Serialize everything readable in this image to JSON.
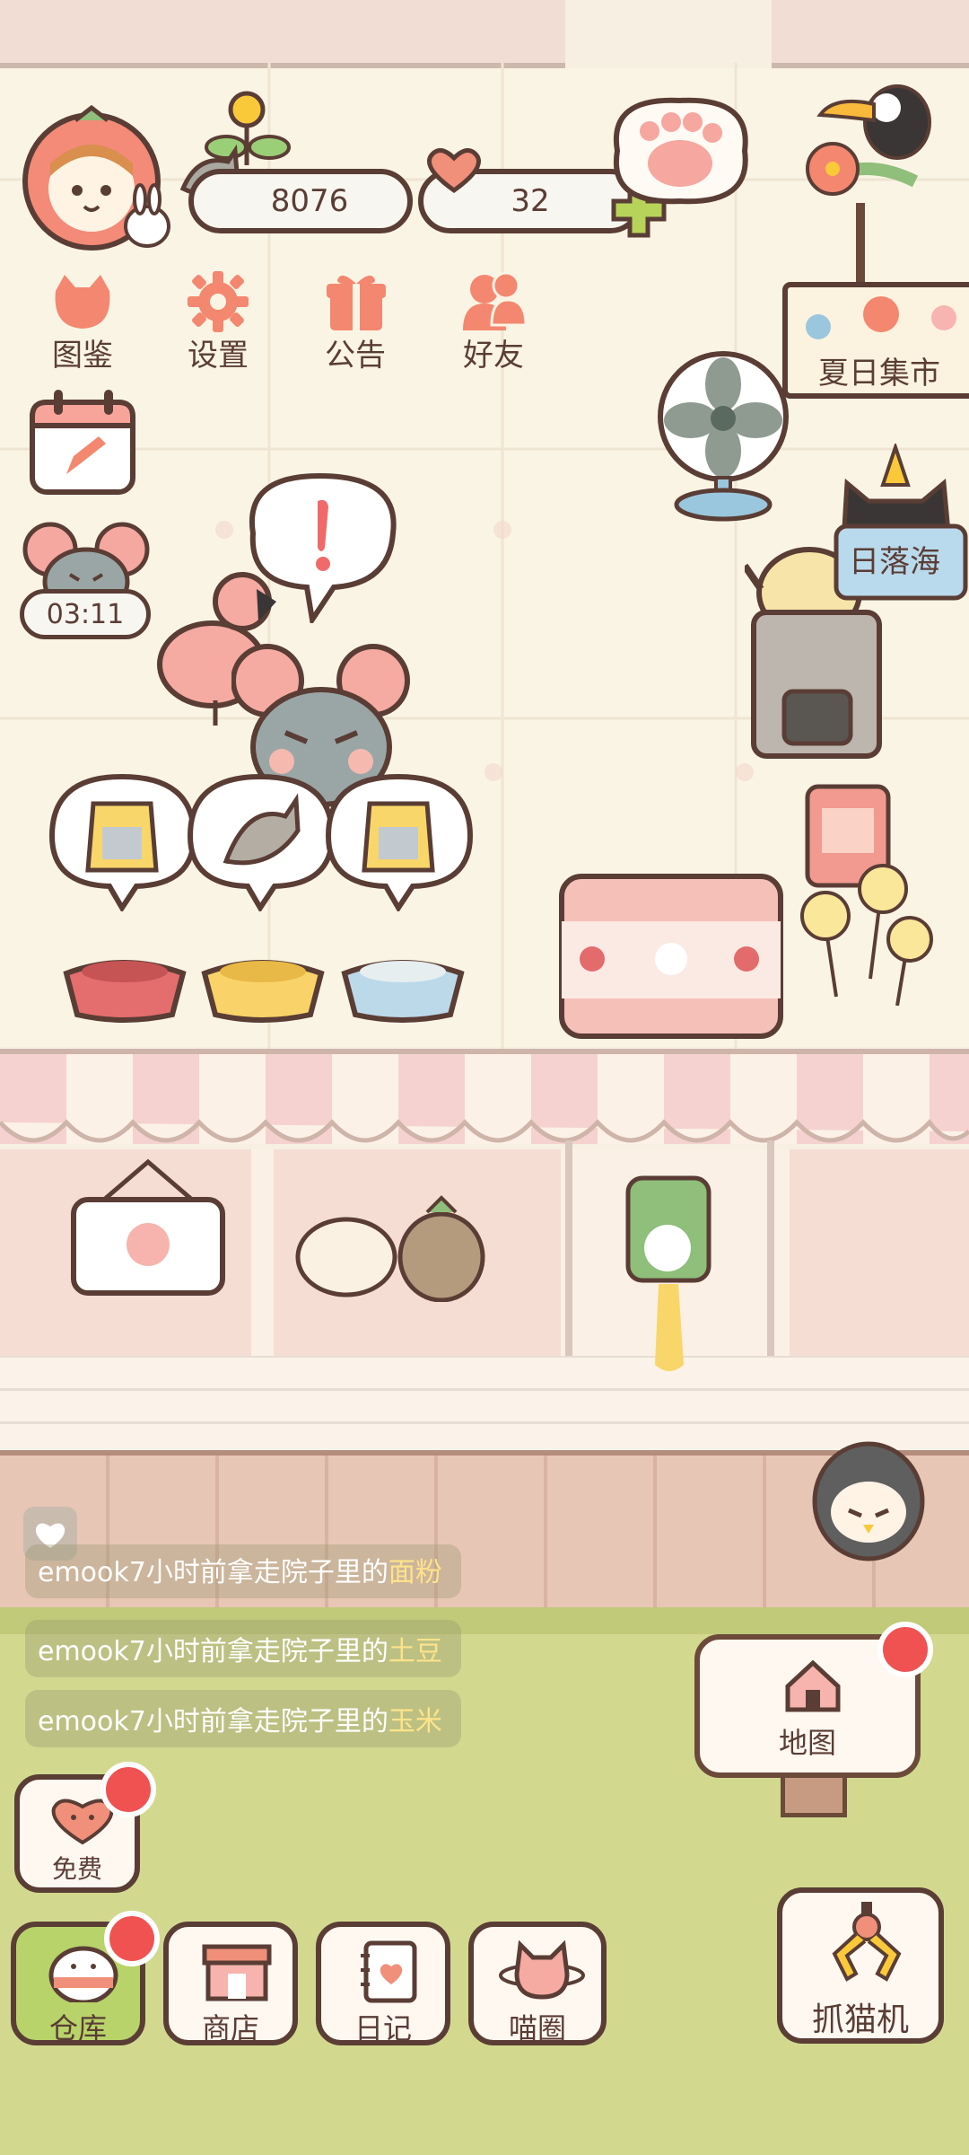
{
  "status": {
    "coins": "8076",
    "hearts": "32",
    "timer": "03:11"
  },
  "menu": [
    {
      "label": "图鉴",
      "icon": "cat-book-icon"
    },
    {
      "label": "设置",
      "icon": "gear-icon"
    },
    {
      "label": "公告",
      "icon": "gift-icon"
    },
    {
      "label": "好友",
      "icon": "friends-icon"
    }
  ],
  "locations": {
    "summer_market": "夏日集市",
    "sunset_sea": "日落海"
  },
  "feed": [
    {
      "prefix": "emook7小时前拿走院子里的",
      "item": "面粉"
    },
    {
      "prefix": "emook7小时前拿走院子里的",
      "item": "土豆"
    },
    {
      "prefix": "emook7小时前拿走院子里的",
      "item": "玉米"
    }
  ],
  "buttons": {
    "free": "免费",
    "map": "地图",
    "claw": "抓猫机"
  },
  "bottom_nav": [
    {
      "label": "仓库",
      "icon": "warehouse-icon"
    },
    {
      "label": "商店",
      "icon": "shop-icon"
    },
    {
      "label": "日记",
      "icon": "diary-icon"
    },
    {
      "label": "喵圈",
      "icon": "planet-cat-icon"
    }
  ],
  "colors": {
    "outline": "#5a3d35",
    "accent_pink": "#f08f7a",
    "badge_red": "#f05252",
    "highlight_yellow": "#ffe38a"
  }
}
